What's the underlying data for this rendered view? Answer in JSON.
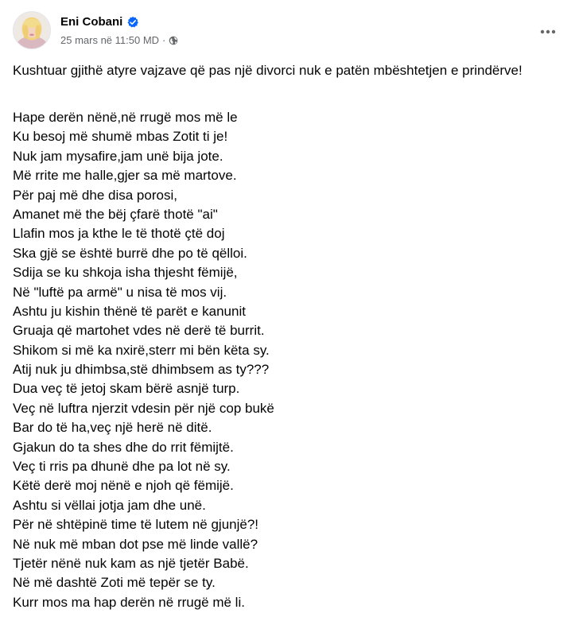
{
  "post": {
    "author": {
      "name": "Eni Cobani",
      "verified": true,
      "avatar": "profile-photo"
    },
    "timestamp": "25 mars në 11:50 MD",
    "separator": "·",
    "audience_icon": "globe-icon",
    "more_icon": "more-options-icon",
    "intro": "Kushtuar gjithë atyre vajzave që pas një divorci nuk e patën mbështetjen e prindërve!",
    "poem_lines": [
      "Hape derën nënë,në rrugë mos më le",
      "Ku besoj më shumë mbas Zotit ti je!",
      "Nuk jam mysafire,jam unë bija jote.",
      "Më rrite me halle,gjer sa më martove.",
      "Për paj më dhe disa porosi,",
      "Amanet më the bëj çfarë thotë \"ai\"",
      "Llafin mos ja kthe le të thotë çtë doj",
      "Ska gjë se është burrë dhe po të qëlloi.",
      "Sdija se ku shkoja isha thjesht fëmijë,",
      "Në \"luftë pa armë\" u nisa të mos vij.",
      "Ashtu ju kishin thënë të parët e kanunit",
      "Gruaja që martohet vdes në derë të burrit.",
      "Shikom si më ka nxirë,sterr mi bën këta sy.",
      "Atij nuk ju dhimbsa,stë dhimbsem as ty???",
      "Dua veç të jetoj skam bërë asnjë turp.",
      "Veç në luftra njerzit vdesin për një cop bukë",
      "Bar do të ha,veç një herë në ditë.",
      "Gjakun do ta shes dhe do rrit fëmijtë.",
      "Veç ti rris pa dhunë dhe pa lot në sy.",
      "Këtë derë moj nënë e njoh që fëmijë.",
      "Ashtu si vëllai jotja jam dhe unë.",
      "Për në shtëpinë time të lutem në gjunjë?!",
      "Në nuk më mban dot pse më linde vallë?",
      "Tjetër nënë nuk kam as një tjetër Babë.",
      "Në më dashtë Zoti më tepër se ty.",
      "Kurr mos ma hap derën në rrugë më li."
    ]
  },
  "colors": {
    "text_primary": "#050505",
    "text_secondary": "#65676b",
    "verified_badge": "#0866ff",
    "background": "#ffffff"
  }
}
